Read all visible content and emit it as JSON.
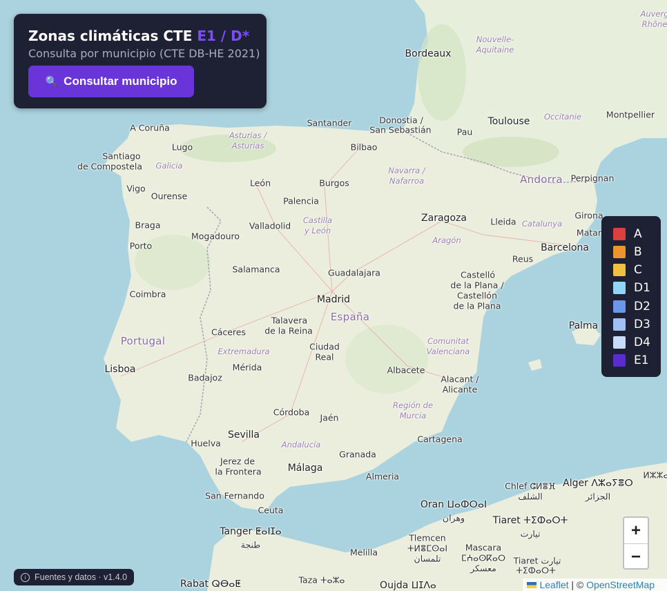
{
  "panel": {
    "title_main": "Zonas climáticas CTE",
    "title_accent": "E1 / D*",
    "subtitle": "Consulta por municipio (CTE DB-HE 2021)",
    "button_label": "Consultar municipio",
    "button_icon": "search-icon"
  },
  "legend": {
    "items": [
      {
        "label": "A",
        "color": "#d94141"
      },
      {
        "label": "B",
        "color": "#e9962f"
      },
      {
        "label": "C",
        "color": "#f0c040"
      },
      {
        "label": "D1",
        "color": "#93d4f5"
      },
      {
        "label": "D2",
        "color": "#6b97e8"
      },
      {
        "label": "D3",
        "color": "#9fbff5"
      },
      {
        "label": "D4",
        "color": "#c9dbfa"
      },
      {
        "label": "E1",
        "color": "#5b2bd0"
      }
    ]
  },
  "zoom": {
    "in_label": "+",
    "out_label": "−"
  },
  "footer": {
    "info_icon": "info-icon",
    "text": "Fuentes y datos · v1.4.0"
  },
  "attribution": {
    "leaflet": "Leaflet",
    "separator": " | © ",
    "osm": "OpenStreetMap"
  },
  "map_labels": {
    "countries": {
      "spain": "España",
      "portugal": "Portugal",
      "andorra": "Andorra"
    },
    "cities": {
      "madrid": "Madrid",
      "barcelona": "Barcelona",
      "bordeaux": "Bordeaux",
      "toulouse": "Toulouse",
      "montpellier": "Montpellier",
      "perpignan": "Perpignan",
      "santander": "Santander",
      "donostia": "Donostia /",
      "donostia2": "San Sebastián",
      "pau": "Pau",
      "acoruna": "A Coruña",
      "lugo": "Lugo",
      "santiago": "Santiago",
      "santiago2": "de Compostela",
      "bilbao": "Bilbao",
      "vigo": "Vigo",
      "ourense": "Ourense",
      "leon": "León",
      "burgos": "Burgos",
      "palencia": "Palencia",
      "braga": "Braga",
      "valladolid": "Valladolid",
      "mogadouro": "Mogadouro",
      "zaragoza": "Zaragoza",
      "lleida": "Lleida",
      "girona": "Girona",
      "mataro": "Matar",
      "porto": "Porto",
      "salamanca": "Salamanca",
      "guadalajara": "Guadalajara",
      "reus": "Reus",
      "castello": "Castelló",
      "castello2": "de la Plana /",
      "castello3": "Castellón",
      "castello4": "de la Plana",
      "coimbra": "Coimbra",
      "talavera": "Talavera",
      "talavera2": "de la Reina",
      "caceres": "Cáceres",
      "palma": "Palma",
      "ciudadreal": "Ciudad",
      "ciudadreal2": "Real",
      "merida": "Mérida",
      "lisboa": "Lisboa",
      "badajoz": "Badajoz",
      "albacete": "Albacete",
      "alacant": "Alacant /",
      "alicante": "Alicante",
      "cordoba": "Córdoba",
      "jaen": "Jaén",
      "sevilla": "Sevilla",
      "huelva": "Huelva",
      "cartagena": "Cartagena",
      "granada": "Granada",
      "jerez": "Jerez de",
      "jerez2": "la Frontera",
      "malaga": "Málaga",
      "almeria": "Almeria",
      "sanfernando": "San Fernando",
      "ceuta": "Ceuta",
      "tanger": "Tanger ⵟⴰⵏⵊⴰ",
      "tanger2": "طنجة",
      "oran": "Oran ⵡⴰⵀⵔⴰⵏ",
      "oran2": "وهران",
      "tiaret": "Tiaret ⵜⵉⵀⴰⵔⵜ",
      "tiaret2": "تيارت",
      "chlef": "Chlef ⵛⵍⴻⴼ",
      "chlef2": "الشلف",
      "alger": "Alger ⴷⵣⴰⵢⴻⵔ",
      "alger2": "الجزائر",
      "tlemcen": "Tlemcen",
      "tlemcen2": "ⵜⵍⴻⵎⵙⴰⵏ",
      "tlemcen3": "تلمسان",
      "mascara": "Mascara",
      "mascara2": "ⵎⵄⴰⵙⴽⴰⵔ",
      "mascara3": "معسكر",
      "tiaret3": "Tiaret تيارت",
      "tiaret4": "ⵜⵉⵀⴰⵔⵜ",
      "melilla": "Melilla",
      "taza": "Taza ⵜⴰⵣⴰ",
      "oujda": "Oujda ⵡⵊⴷⴰ",
      "rabat": "Rabat ⵕⴱⴰⵟ",
      "algeria_right": "ⵍⵣⵣⴰ"
    },
    "regions": {
      "asturias": "Asturias /",
      "asturias2": "Asturias",
      "galicia": "Galicia",
      "navarra": "Navarra /",
      "navarra2": "Nafarroa",
      "castillaleon": "Castilla",
      "castillaleon2": "y León",
      "aragon": "Aragón",
      "catalunya": "Catalunya",
      "occitanie": "Occitanie",
      "nouvelle": "Nouvelle-",
      "nouvelle2": "Aquitaine",
      "auvergne": "Auverg",
      "auvergne2": "Rhône",
      "extremadura": "Extremadura",
      "comunitat": "Comunitat",
      "comunitat2": "Valenciana",
      "murcia": "Región de",
      "murcia2": "Murcia",
      "andalucia": "Andalucía"
    }
  }
}
